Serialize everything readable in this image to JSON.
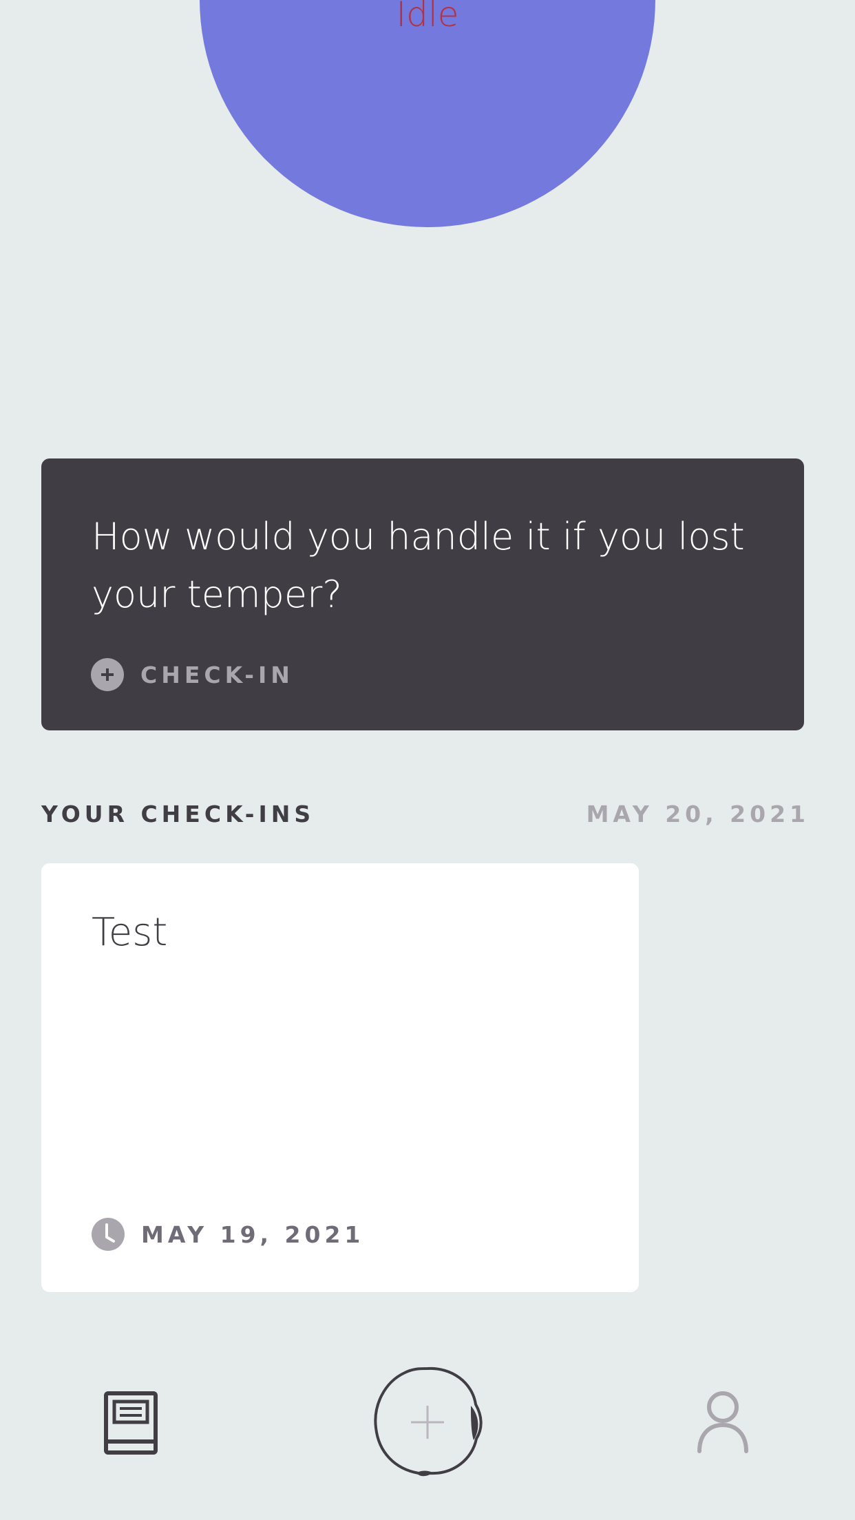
{
  "mood": {
    "label": "Idle",
    "circle_color": "#7379dd",
    "label_color": "#b5313e"
  },
  "prompt_card": {
    "question": "How would you handle it if you lost your temper?",
    "action_icon": "plus-icon",
    "action_label": "CHECK-IN"
  },
  "checkins": {
    "section_title": "YOUR CHECK-INS",
    "current_date": "MAY 20, 2021",
    "entries": [
      {
        "title": "Test",
        "date_icon": "clock-icon",
        "date": "MAY 19, 2021"
      }
    ]
  },
  "tab_bar": {
    "items": [
      {
        "icon": "journal-icon"
      },
      {
        "icon": "add-entry-icon"
      },
      {
        "icon": "profile-icon"
      }
    ]
  },
  "colors": {
    "background": "#e6ebeb",
    "dark_card": "#403d44",
    "muted_text": "#aaa6ad"
  }
}
